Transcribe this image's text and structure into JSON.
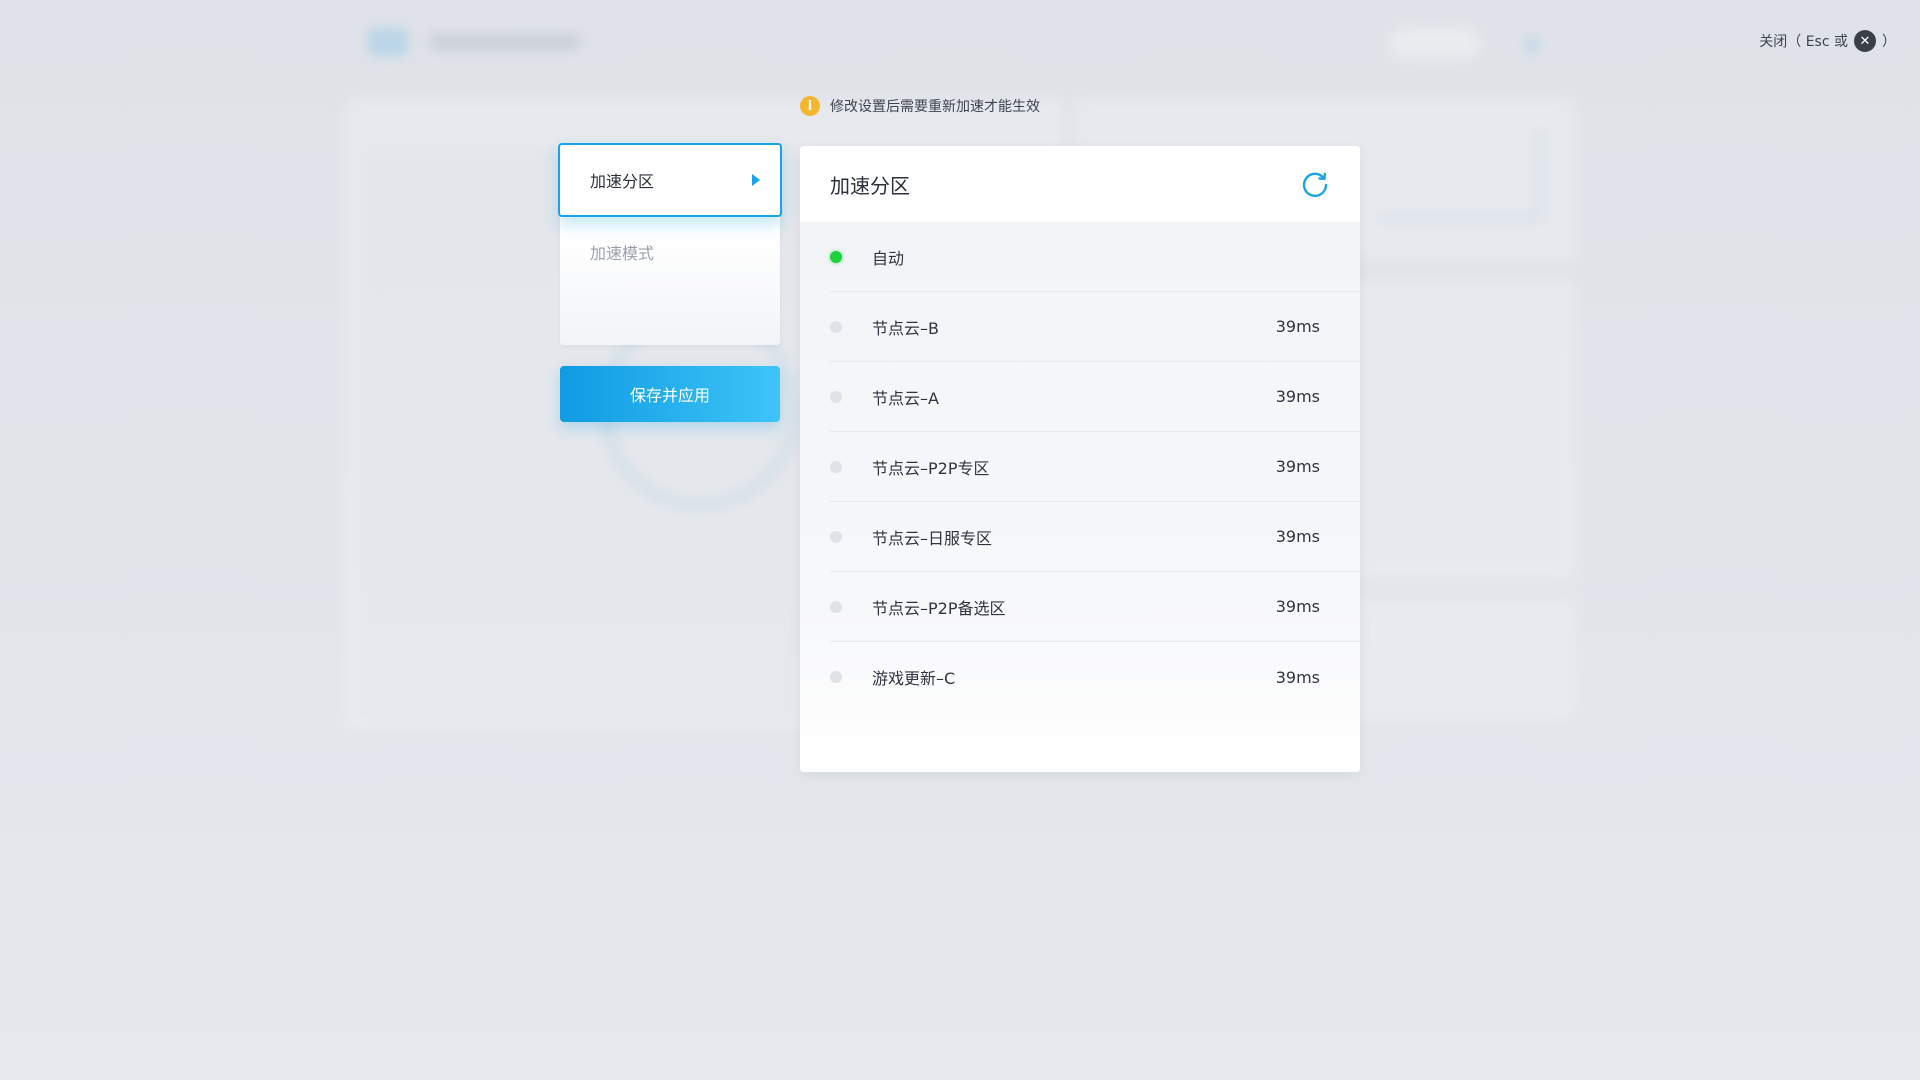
{
  "notice": {
    "text": "修改设置后需要重新加速才能生效",
    "icon": "info-icon",
    "icon_glyph": "i"
  },
  "close_hint": {
    "prefix": "关闭（ Esc 或",
    "suffix": "）",
    "icon": "close-icon",
    "icon_glyph": "✕"
  },
  "menu": {
    "items": [
      {
        "label": "加速分区",
        "active": true
      },
      {
        "label": "加速模式",
        "active": false
      }
    ]
  },
  "save_button": {
    "label": "保存并应用"
  },
  "panel": {
    "title": "加速分区",
    "refresh_icon": "refresh-icon",
    "rows": [
      {
        "name": "自动",
        "ping": "",
        "selected": true
      },
      {
        "name": "节点云–B",
        "ping": "39ms",
        "selected": false
      },
      {
        "name": "节点云–A",
        "ping": "39ms",
        "selected": false
      },
      {
        "name": "节点云–P2P专区",
        "ping": "39ms",
        "selected": false
      },
      {
        "name": "节点云–日服专区",
        "ping": "39ms",
        "selected": false
      },
      {
        "name": "节点云–P2P备选区",
        "ping": "39ms",
        "selected": false
      },
      {
        "name": "游戏更新–C",
        "ping": "39ms",
        "selected": false
      }
    ]
  },
  "colors": {
    "accent": "#1aa3e8",
    "status_on": "#1fd13b",
    "warning": "#f5b731"
  }
}
